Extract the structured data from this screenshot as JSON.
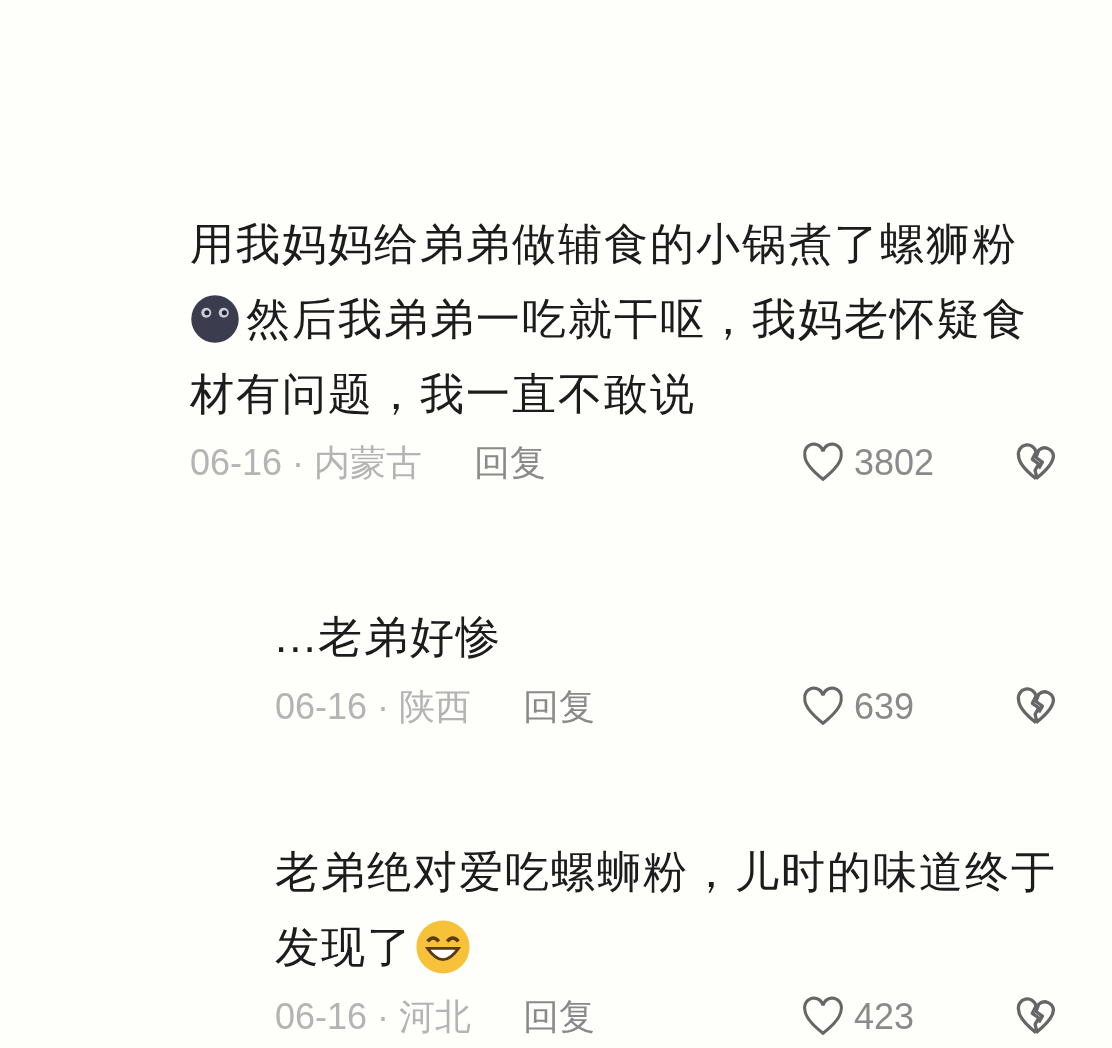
{
  "comments": [
    {
      "kind": "top",
      "lines": [
        [
          {
            "kind": "text",
            "text": "用我妈妈给弟弟做辅食的小锅煮了螺狮粉"
          }
        ],
        [
          {
            "kind": "moon_emoji"
          },
          {
            "kind": "text",
            "text": "然后我弟弟一吃就干呕，我妈老怀疑食"
          }
        ],
        [
          {
            "kind": "text",
            "text": "材有问题，我一直不敢说"
          }
        ]
      ],
      "meta": "06-16 · 内蒙古",
      "reply_label": "回复",
      "likes": "3802"
    },
    {
      "kind": "reply",
      "lines": [
        [
          {
            "kind": "text",
            "text": "...老弟好惨"
          }
        ]
      ],
      "meta": "06-16 · 陕西",
      "reply_label": "回复",
      "likes": "639"
    },
    {
      "kind": "reply",
      "lines": [
        [
          {
            "kind": "text",
            "text": "老弟绝对爱吃螺蛳粉，儿时的味道终于"
          }
        ],
        [
          {
            "kind": "text",
            "text": "发现了"
          },
          {
            "kind": "grin_emoji"
          }
        ]
      ],
      "meta": "06-16 · 河北",
      "reply_label": "回复",
      "likes": "423"
    }
  ]
}
